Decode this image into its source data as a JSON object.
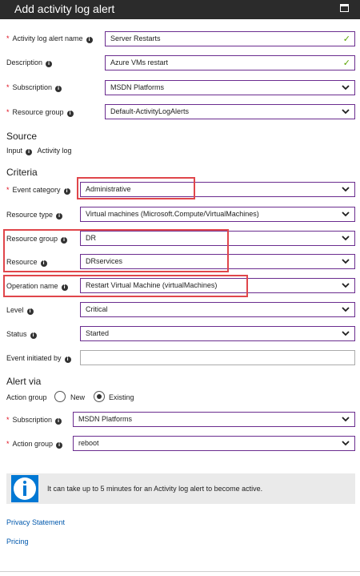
{
  "header": {
    "title": "Add activity log alert"
  },
  "fields": {
    "alert_name": {
      "label": "Activity log alert name",
      "value": "Server Restarts"
    },
    "description": {
      "label": "Description",
      "value": "Azure VMs restart"
    },
    "subscription": {
      "label": "Subscription",
      "value": "MSDN Platforms"
    },
    "resource_group": {
      "label": "Resource group",
      "value": "Default-ActivityLogAlerts"
    }
  },
  "source": {
    "heading": "Source",
    "input_label": "Input",
    "input_value": "Activity log"
  },
  "criteria": {
    "heading": "Criteria",
    "event_category": {
      "label": "Event category",
      "value": "Administrative"
    },
    "resource_type": {
      "label": "Resource type",
      "value": "Virtual machines (Microsoft.Compute/VirtualMachines)"
    },
    "resource_group": {
      "label": "Resource group",
      "value": "DR"
    },
    "resource": {
      "label": "Resource",
      "value": "DRservices"
    },
    "operation_name": {
      "label": "Operation name",
      "value": "Restart Virtual Machine (virtualMachines)"
    },
    "level": {
      "label": "Level",
      "value": "Critical"
    },
    "status": {
      "label": "Status",
      "value": "Started"
    },
    "event_initiated_by": {
      "label": "Event initiated by",
      "value": ""
    }
  },
  "alert_via": {
    "heading": "Alert via",
    "action_group_label": "Action group",
    "option_new": "New",
    "option_existing": "Existing",
    "subscription": {
      "label": "Subscription",
      "value": "MSDN Platforms"
    },
    "action_group": {
      "label": "Action group",
      "value": "reboot"
    }
  },
  "info_message": "It can take up to 5 minutes for an Activity log alert to become active.",
  "links": {
    "privacy": "Privacy Statement",
    "pricing": "Pricing"
  },
  "colors": {
    "header_bg": "#2b2b2b",
    "required": "#e00b1c",
    "field_border_active": "#6b2d8f",
    "valid_check": "#57a300",
    "highlight": "#e0464b",
    "link": "#0058ad",
    "info_icon": "#0078d4"
  }
}
